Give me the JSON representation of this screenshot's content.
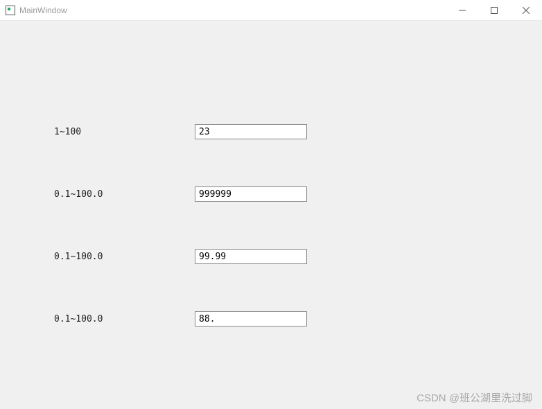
{
  "window": {
    "title": "MainWindow"
  },
  "rows": [
    {
      "label": "1~100",
      "value": "23"
    },
    {
      "label": "0.1~100.0",
      "value": "999999"
    },
    {
      "label": "0.1~100.0",
      "value": "99.99"
    },
    {
      "label": "0.1~100.0",
      "value": "88."
    }
  ],
  "watermark": "CSDN @班公湖里洗过脚"
}
